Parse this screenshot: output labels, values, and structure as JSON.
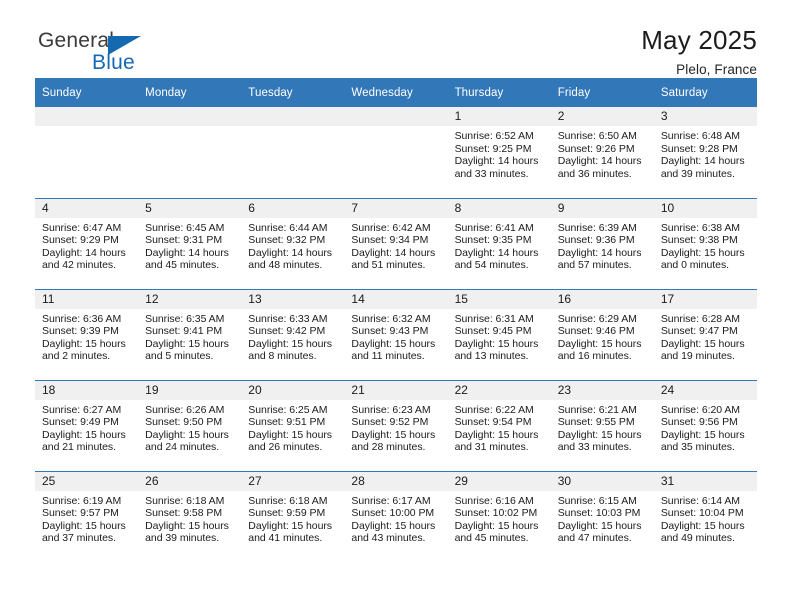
{
  "logo": {
    "word_top": "General",
    "word_bottom": "Blue"
  },
  "header": {
    "title": "May 2025",
    "location": "Plelo, France"
  },
  "colors": {
    "header_blue": "#3277b8",
    "logo_blue": "#1569b0",
    "daynum_band": "#f0f0f0"
  },
  "weekday_headers": [
    "Sunday",
    "Monday",
    "Tuesday",
    "Wednesday",
    "Thursday",
    "Friday",
    "Saturday"
  ],
  "weeks": [
    [
      {
        "day": "",
        "lines": []
      },
      {
        "day": "",
        "lines": []
      },
      {
        "day": "",
        "lines": []
      },
      {
        "day": "",
        "lines": []
      },
      {
        "day": "1",
        "lines": [
          "Sunrise: 6:52 AM",
          "Sunset: 9:25 PM",
          "Daylight: 14 hours",
          "and 33 minutes."
        ]
      },
      {
        "day": "2",
        "lines": [
          "Sunrise: 6:50 AM",
          "Sunset: 9:26 PM",
          "Daylight: 14 hours",
          "and 36 minutes."
        ]
      },
      {
        "day": "3",
        "lines": [
          "Sunrise: 6:48 AM",
          "Sunset: 9:28 PM",
          "Daylight: 14 hours",
          "and 39 minutes."
        ]
      }
    ],
    [
      {
        "day": "4",
        "lines": [
          "Sunrise: 6:47 AM",
          "Sunset: 9:29 PM",
          "Daylight: 14 hours",
          "and 42 minutes."
        ]
      },
      {
        "day": "5",
        "lines": [
          "Sunrise: 6:45 AM",
          "Sunset: 9:31 PM",
          "Daylight: 14 hours",
          "and 45 minutes."
        ]
      },
      {
        "day": "6",
        "lines": [
          "Sunrise: 6:44 AM",
          "Sunset: 9:32 PM",
          "Daylight: 14 hours",
          "and 48 minutes."
        ]
      },
      {
        "day": "7",
        "lines": [
          "Sunrise: 6:42 AM",
          "Sunset: 9:34 PM",
          "Daylight: 14 hours",
          "and 51 minutes."
        ]
      },
      {
        "day": "8",
        "lines": [
          "Sunrise: 6:41 AM",
          "Sunset: 9:35 PM",
          "Daylight: 14 hours",
          "and 54 minutes."
        ]
      },
      {
        "day": "9",
        "lines": [
          "Sunrise: 6:39 AM",
          "Sunset: 9:36 PM",
          "Daylight: 14 hours",
          "and 57 minutes."
        ]
      },
      {
        "day": "10",
        "lines": [
          "Sunrise: 6:38 AM",
          "Sunset: 9:38 PM",
          "Daylight: 15 hours",
          "and 0 minutes."
        ]
      }
    ],
    [
      {
        "day": "11",
        "lines": [
          "Sunrise: 6:36 AM",
          "Sunset: 9:39 PM",
          "Daylight: 15 hours",
          "and 2 minutes."
        ]
      },
      {
        "day": "12",
        "lines": [
          "Sunrise: 6:35 AM",
          "Sunset: 9:41 PM",
          "Daylight: 15 hours",
          "and 5 minutes."
        ]
      },
      {
        "day": "13",
        "lines": [
          "Sunrise: 6:33 AM",
          "Sunset: 9:42 PM",
          "Daylight: 15 hours",
          "and 8 minutes."
        ]
      },
      {
        "day": "14",
        "lines": [
          "Sunrise: 6:32 AM",
          "Sunset: 9:43 PM",
          "Daylight: 15 hours",
          "and 11 minutes."
        ]
      },
      {
        "day": "15",
        "lines": [
          "Sunrise: 6:31 AM",
          "Sunset: 9:45 PM",
          "Daylight: 15 hours",
          "and 13 minutes."
        ]
      },
      {
        "day": "16",
        "lines": [
          "Sunrise: 6:29 AM",
          "Sunset: 9:46 PM",
          "Daylight: 15 hours",
          "and 16 minutes."
        ]
      },
      {
        "day": "17",
        "lines": [
          "Sunrise: 6:28 AM",
          "Sunset: 9:47 PM",
          "Daylight: 15 hours",
          "and 19 minutes."
        ]
      }
    ],
    [
      {
        "day": "18",
        "lines": [
          "Sunrise: 6:27 AM",
          "Sunset: 9:49 PM",
          "Daylight: 15 hours",
          "and 21 minutes."
        ]
      },
      {
        "day": "19",
        "lines": [
          "Sunrise: 6:26 AM",
          "Sunset: 9:50 PM",
          "Daylight: 15 hours",
          "and 24 minutes."
        ]
      },
      {
        "day": "20",
        "lines": [
          "Sunrise: 6:25 AM",
          "Sunset: 9:51 PM",
          "Daylight: 15 hours",
          "and 26 minutes."
        ]
      },
      {
        "day": "21",
        "lines": [
          "Sunrise: 6:23 AM",
          "Sunset: 9:52 PM",
          "Daylight: 15 hours",
          "and 28 minutes."
        ]
      },
      {
        "day": "22",
        "lines": [
          "Sunrise: 6:22 AM",
          "Sunset: 9:54 PM",
          "Daylight: 15 hours",
          "and 31 minutes."
        ]
      },
      {
        "day": "23",
        "lines": [
          "Sunrise: 6:21 AM",
          "Sunset: 9:55 PM",
          "Daylight: 15 hours",
          "and 33 minutes."
        ]
      },
      {
        "day": "24",
        "lines": [
          "Sunrise: 6:20 AM",
          "Sunset: 9:56 PM",
          "Daylight: 15 hours",
          "and 35 minutes."
        ]
      }
    ],
    [
      {
        "day": "25",
        "lines": [
          "Sunrise: 6:19 AM",
          "Sunset: 9:57 PM",
          "Daylight: 15 hours",
          "and 37 minutes."
        ]
      },
      {
        "day": "26",
        "lines": [
          "Sunrise: 6:18 AM",
          "Sunset: 9:58 PM",
          "Daylight: 15 hours",
          "and 39 minutes."
        ]
      },
      {
        "day": "27",
        "lines": [
          "Sunrise: 6:18 AM",
          "Sunset: 9:59 PM",
          "Daylight: 15 hours",
          "and 41 minutes."
        ]
      },
      {
        "day": "28",
        "lines": [
          "Sunrise: 6:17 AM",
          "Sunset: 10:00 PM",
          "Daylight: 15 hours",
          "and 43 minutes."
        ]
      },
      {
        "day": "29",
        "lines": [
          "Sunrise: 6:16 AM",
          "Sunset: 10:02 PM",
          "Daylight: 15 hours",
          "and 45 minutes."
        ]
      },
      {
        "day": "30",
        "lines": [
          "Sunrise: 6:15 AM",
          "Sunset: 10:03 PM",
          "Daylight: 15 hours",
          "and 47 minutes."
        ]
      },
      {
        "day": "31",
        "lines": [
          "Sunrise: 6:14 AM",
          "Sunset: 10:04 PM",
          "Daylight: 15 hours",
          "and 49 minutes."
        ]
      }
    ]
  ]
}
